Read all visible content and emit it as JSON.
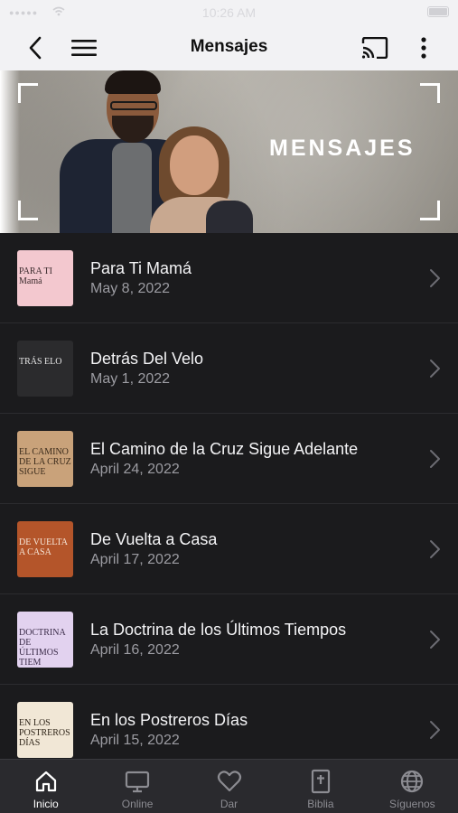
{
  "status_bar": {
    "time": "10:26 AM",
    "signal": "●●●●●"
  },
  "nav": {
    "title": "Mensajes",
    "icons": [
      "back-chevron-icon",
      "hamburger-menu-icon",
      "cast-icon",
      "more-vertical-icon"
    ]
  },
  "banner": {
    "title": "MENSAJES"
  },
  "messages": [
    {
      "title": "Para Ti Mamá",
      "date": "May 8, 2022",
      "thumb_text": "PARA TI Mamá",
      "thumb_bg": "#f3c8cf",
      "thumb_fg": "#3a2a2c"
    },
    {
      "title": "Detrás Del Velo",
      "date": "May 1, 2022",
      "thumb_text": "TRÁS ELO",
      "thumb_bg": "#2b2b2d",
      "thumb_fg": "#e6e6e6"
    },
    {
      "title": "El Camino de la Cruz Sigue Adelante",
      "date": "April 24, 2022",
      "thumb_text": "EL CAMINO DE LA CRUZ SIGUE",
      "thumb_bg": "#c9a27a",
      "thumb_fg": "#3b2b1b"
    },
    {
      "title": "De Vuelta a Casa",
      "date": "April 17, 2022",
      "thumb_text": "DE VUELTA A CASA",
      "thumb_bg": "#b4552a",
      "thumb_fg": "#f6e6d8"
    },
    {
      "title": "La Doctrina de los Últimos Tiempos",
      "date": "April 16, 2022",
      "thumb_text": "DOCTRINA DE ÚLTIMOS TIEM",
      "thumb_bg": "#e2d2ef",
      "thumb_fg": "#3c2d4a"
    },
    {
      "title": "En los Postreros Días",
      "date": "April 15, 2022",
      "thumb_text": "EN LOS POSTREROS DÍAS",
      "thumb_bg": "#f1e7d6",
      "thumb_fg": "#2e2418"
    }
  ],
  "tabs": [
    {
      "label": "Inicio",
      "icon": "home-icon",
      "active": true
    },
    {
      "label": "Online",
      "icon": "monitor-icon",
      "active": false
    },
    {
      "label": "Dar",
      "icon": "heart-icon",
      "active": false
    },
    {
      "label": "Biblia",
      "icon": "bible-icon",
      "active": false
    },
    {
      "label": "Síguenos",
      "icon": "globe-icon",
      "active": false
    }
  ],
  "colors": {
    "nav_bg": "#f2f2f4",
    "list_bg": "#1b1b1d",
    "tab_bg": "#2a2a2e",
    "active_tab": "#ffffff",
    "inactive_tab": "#8c8c92"
  }
}
